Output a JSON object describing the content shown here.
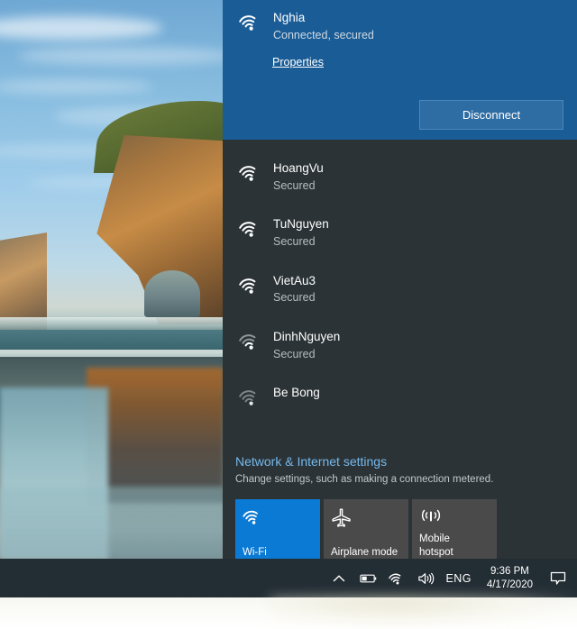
{
  "desktop": {
    "wallpaper_name": "wharariki-beach-arch",
    "sky_color": "#87bcdf",
    "rock_color": "#c78c46",
    "water_color": "#3e6b76"
  },
  "flyout": {
    "panel_bg": "#2b3336",
    "accent_color": "#1a5c96",
    "connected": {
      "ssid": "Nghia",
      "status": "Connected, secured",
      "properties_label": "Properties",
      "disconnect_label": "Disconnect",
      "wifi_icon": "wifi-full-icon",
      "button_color": "#2e6da4"
    },
    "networks": [
      {
        "ssid": "HoangVu",
        "status": "Secured",
        "icon": "wifi-full-icon",
        "strength": 4
      },
      {
        "ssid": "TuNguyen",
        "status": "Secured",
        "icon": "wifi-full-icon",
        "strength": 4
      },
      {
        "ssid": "VietAu3",
        "status": "Secured",
        "icon": "wifi-full-icon",
        "strength": 4
      },
      {
        "ssid": "DinhNguyen",
        "status": "Secured",
        "icon": "wifi-weak-icon",
        "strength": 2
      },
      {
        "ssid": "Be Bong",
        "status": "",
        "icon": "wifi-weak-icon",
        "strength": 1
      }
    ],
    "settings": {
      "title": "Network & Internet settings",
      "title_color": "#76b9ed",
      "subtitle": "Change settings, such as making a connection metered."
    },
    "tiles": [
      {
        "label": "Wi-Fi",
        "icon": "wifi-icon",
        "state": "on",
        "color": "#0b7ad4"
      },
      {
        "label": "Airplane mode",
        "icon": "airplane-icon",
        "state": "off",
        "color": "#4a4a4a"
      },
      {
        "label": "Mobile\nhotspot",
        "icon": "mobile-hotspot-icon",
        "state": "off",
        "color": "#4a4a4a"
      }
    ]
  },
  "annotation": {
    "shape": "down-arrow",
    "color": "#f41f1f",
    "points_to": "Disconnect"
  },
  "taskbar": {
    "bg_color": "#232d34",
    "tray_icons": [
      "chevron-up-icon",
      "battery-icon",
      "wifi-icon",
      "volume-icon"
    ],
    "language": "ENG",
    "clock": {
      "time": "9:36 PM",
      "date": "4/17/2020"
    },
    "action_center_icon": "action-center-icon"
  }
}
